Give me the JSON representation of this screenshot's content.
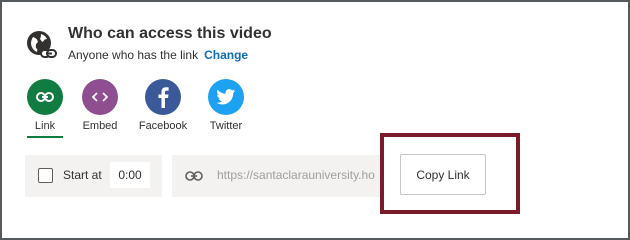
{
  "header": {
    "title": "Who can access this video",
    "access_text": "Anyone who has the link",
    "change_label": "Change"
  },
  "share_options": [
    {
      "label": "Link",
      "icon": "link-icon",
      "color": "#107c41",
      "active": true
    },
    {
      "label": "Embed",
      "icon": "embed-icon",
      "color": "#8e4e8f",
      "active": false
    },
    {
      "label": "Facebook",
      "icon": "facebook-icon",
      "color": "#3b5998",
      "active": false
    },
    {
      "label": "Twitter",
      "icon": "twitter-icon",
      "color": "#1da1f2",
      "active": false
    }
  ],
  "start_at": {
    "label": "Start at",
    "value": "0:00",
    "checked": false
  },
  "link": {
    "url": "https://santaclarauniversity.ho"
  },
  "copy_button": {
    "label": "Copy Link"
  },
  "colors": {
    "highlight_border": "#7b1a29",
    "link_accent": "#0f6cbd"
  }
}
